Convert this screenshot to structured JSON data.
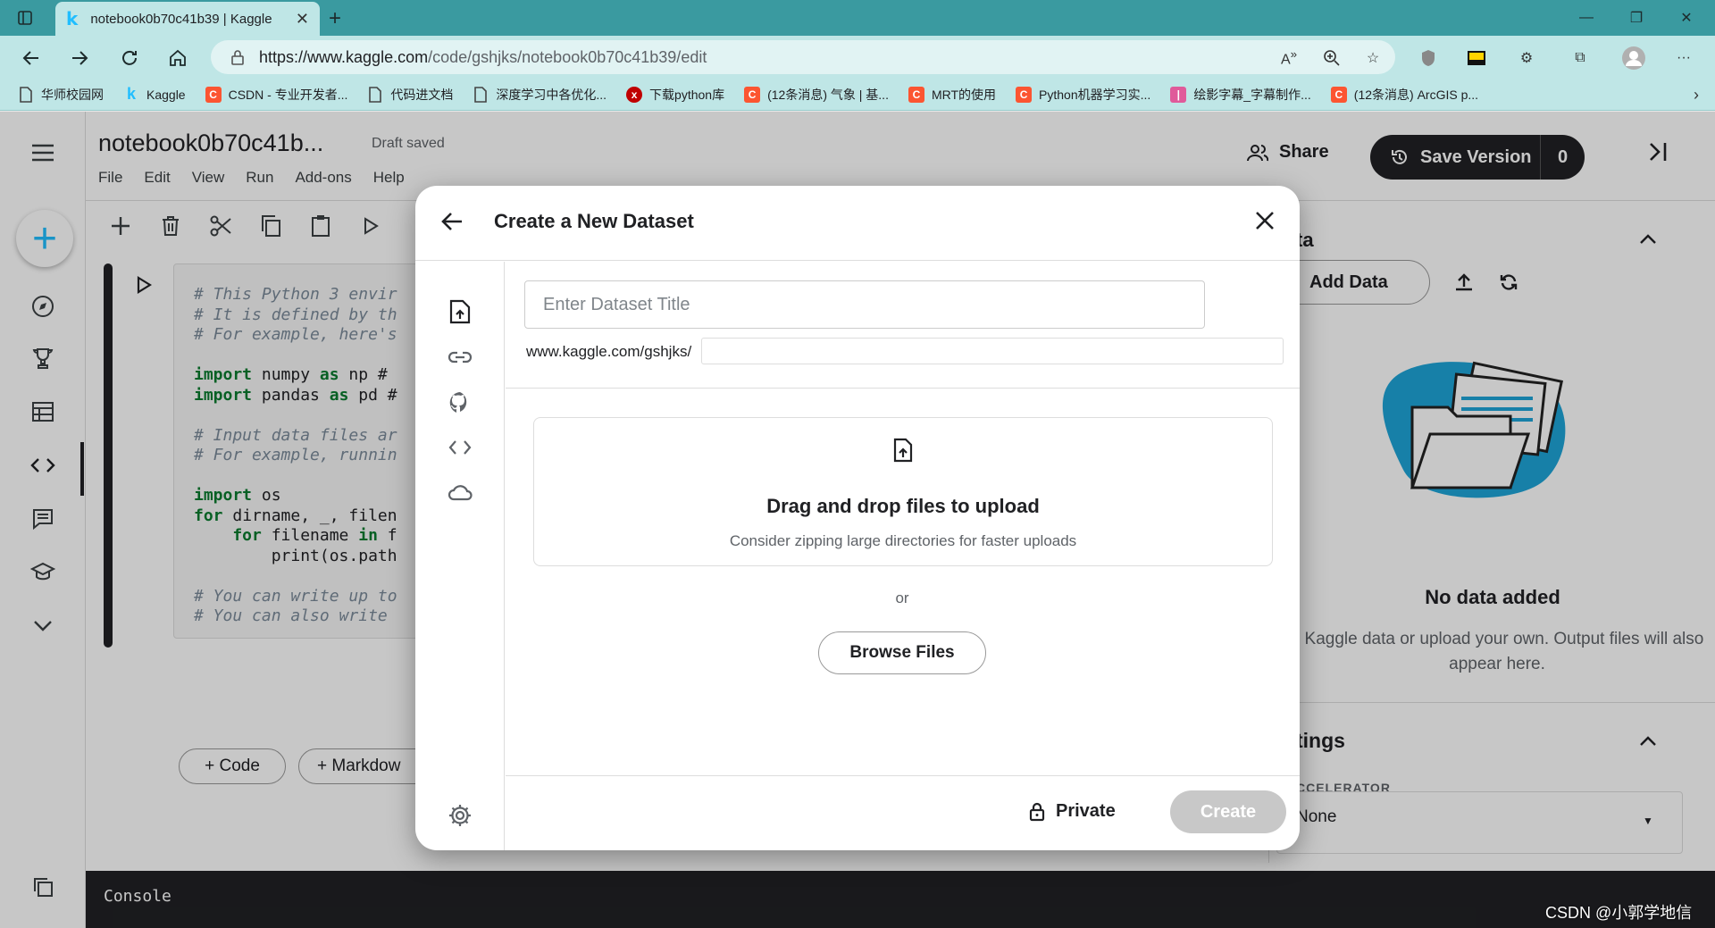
{
  "browser": {
    "tab_title": "notebook0b70c41b39 | Kaggle",
    "url_host": "https://www.kaggle.com",
    "url_path": "/code/gshjks/notebook0b70c41b39/edit",
    "bookmarks": [
      {
        "label": "华师校园网",
        "icon": "page-icon",
        "color": "#555555"
      },
      {
        "label": "Kaggle",
        "icon": "kaggle-icon",
        "color": "#20beff"
      },
      {
        "label": "CSDN - 专业开发者...",
        "icon": "csdn-icon",
        "color": "#fc5531"
      },
      {
        "label": "代码进文档",
        "icon": "page-icon",
        "color": "#555555"
      },
      {
        "label": "深度学习中各优化...",
        "icon": "page-icon",
        "color": "#555555"
      },
      {
        "label": "下载python库",
        "icon": "python-icon",
        "color": "#c00000"
      },
      {
        "label": "(12条消息) 气象 | 基...",
        "icon": "csdn-icon",
        "color": "#fc5531"
      },
      {
        "label": "MRT的使用",
        "icon": "csdn-icon",
        "color": "#fc5531"
      },
      {
        "label": "Python机器学习实...",
        "icon": "csdn-icon",
        "color": "#fc5531"
      },
      {
        "label": "绘影字幕_字幕制作...",
        "icon": "subtitle-icon",
        "color": "#e05a9a"
      },
      {
        "label": "(12条消息) ArcGIS p...",
        "icon": "csdn-icon",
        "color": "#fc5531"
      }
    ]
  },
  "notebook": {
    "title": "notebook0b70c41b...",
    "status": "Draft saved",
    "menu": [
      "File",
      "Edit",
      "View",
      "Run",
      "Add-ons",
      "Help"
    ],
    "share_label": "Share",
    "save_version_label": "Save Version",
    "save_version_count": "0",
    "add_code_label": "+ Code",
    "add_markdown_label": "+ Markdow",
    "console_label": "Console"
  },
  "code_lines": [
    {
      "type": "cm",
      "text": "# This Python 3 envir"
    },
    {
      "type": "cm",
      "text": "# It is defined by th"
    },
    {
      "type": "cm",
      "text": "# For example, here's"
    },
    {
      "type": "blank",
      "text": ""
    },
    {
      "type": "imp",
      "kw1": "import",
      "mid": " numpy ",
      "kw2": "as",
      "rest": " np #"
    },
    {
      "type": "imp",
      "kw1": "import",
      "mid": " pandas ",
      "kw2": "as",
      "rest": " pd #"
    },
    {
      "type": "blank",
      "text": ""
    },
    {
      "type": "cm",
      "text": "# Input data files ar"
    },
    {
      "type": "cm",
      "text": "# For example, runnin"
    },
    {
      "type": "blank",
      "text": ""
    },
    {
      "type": "imp",
      "kw1": "import",
      "mid": " os",
      "kw2": "",
      "rest": ""
    },
    {
      "type": "imp",
      "kw1": "for",
      "mid": " dirname, _, filen",
      "kw2": "",
      "rest": ""
    },
    {
      "type": "imp",
      "kw1": "    for",
      "mid": " filename ",
      "kw2": "in",
      "rest": " f"
    },
    {
      "type": "plain",
      "text": "        print(os.path"
    },
    {
      "type": "blank",
      "text": ""
    },
    {
      "type": "cm",
      "text": "# You can write up to"
    },
    {
      "type": "cm",
      "text": "# You can also write"
    }
  ],
  "right_panel": {
    "data_title": "ta",
    "add_data_label": "Add Data",
    "no_data_title": "No data added",
    "no_data_sub": "d Kaggle data or upload your own. Output files will also appear here.",
    "settings_title": "tings",
    "accelerator_label": "CCELERATOR",
    "accelerator_value": "None"
  },
  "modal": {
    "title": "Create a New Dataset",
    "title_placeholder": "Enter Dataset Title",
    "url_prefix": "www.kaggle.com/gshjks/",
    "dropzone_title": "Drag and drop files to upload",
    "dropzone_sub": "Consider zipping large directories for faster uploads",
    "or_label": "or",
    "browse_label": "Browse Files",
    "private_label": "Private",
    "create_label": "Create"
  },
  "watermark": "CSDN @小郭学地信",
  "colors": {
    "kaggle_blue": "#20beff",
    "browser_teal": "#3a9aa0",
    "create_disabled": "#c8c8c8"
  }
}
